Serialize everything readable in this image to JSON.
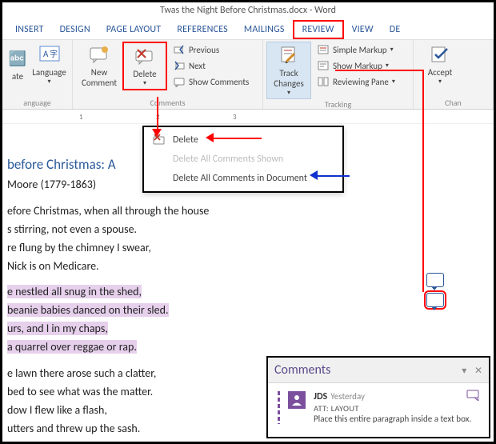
{
  "title": "Twas the Night Before Christmas.docx - Word",
  "tabs": [
    "INSERT",
    "DESIGN",
    "PAGE LAYOUT",
    "REFERENCES",
    "MAILINGS",
    "REVIEW",
    "VIEW",
    "DE"
  ],
  "active_tab_index": 5,
  "ribbon": {
    "language": {
      "ate": "ate",
      "language": "Language",
      "group_label": "anguage"
    },
    "comments": {
      "new_comment": "New\nComment",
      "delete": "Delete",
      "previous": "Previous",
      "next": "Next",
      "show_comments": "Show Comments",
      "group_label": "Comments"
    },
    "tracking": {
      "track_changes": "Track\nChanges",
      "simple_markup": "Simple Markup",
      "show_markup": "Show Markup",
      "reviewing_pane": "Reviewing Pane",
      "group_label": "Tracking"
    },
    "changes": {
      "accept": "Accept",
      "group_label": "Chan"
    }
  },
  "delete_menu": {
    "delete": "Delete",
    "delete_shown": "Delete All Comments Shown",
    "delete_all": "Delete All Comments in Document"
  },
  "doc": {
    "h1": "before Christmas: A",
    "byline": "Moore (1779-1863)",
    "s1l1": "efore Christmas, when all through the house",
    "s1l2": "s stirring, not even a spouse.",
    "s1l3": "re flung by the chimney I swear,",
    "s1l4": "Nick is on Medicare.",
    "s2l1": "e nestled all snug in the shed,",
    "s2l2": "beanie babies danced on their sled.",
    "s2l3": "urs, and I in my chaps,",
    "s2l4": "a quarrel over reggae or rap.",
    "s3l1": "e lawn there arose such a clatter,",
    "s3l2": "bed to see what was the matter.",
    "s3l3": "dow I flew like a flash,",
    "s3l4": "utters and threw up the sash."
  },
  "ruler_marks": [
    "1",
    "2",
    "3"
  ],
  "comment_pane": {
    "title": "Comments",
    "author": "JDS",
    "when": "Yesterday",
    "att": "ATT: LAYOUT",
    "text": "Place this entire paragraph inside a text box."
  }
}
